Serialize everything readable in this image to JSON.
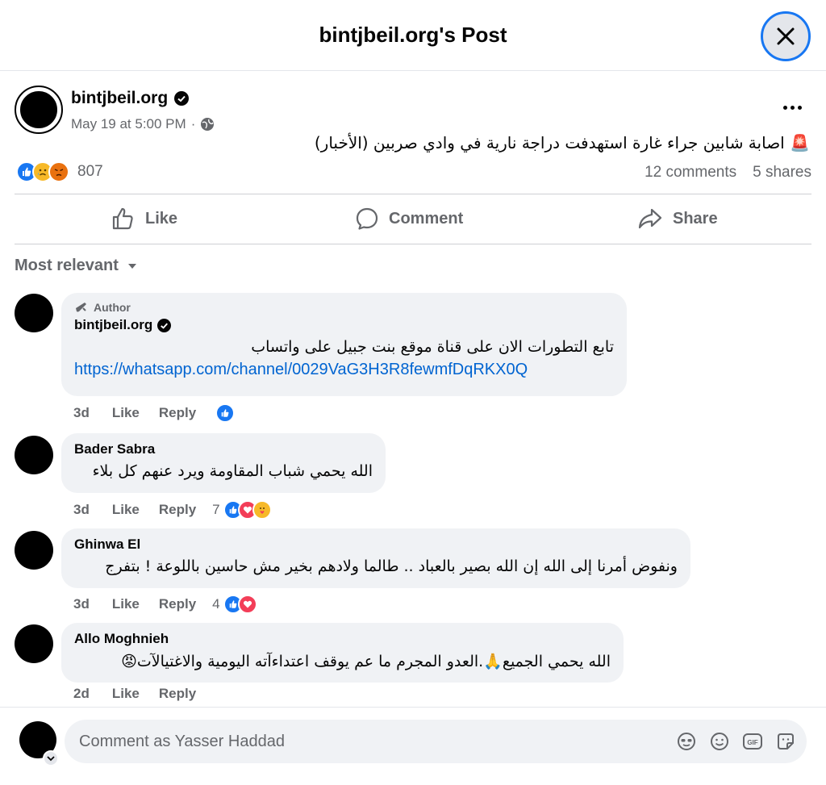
{
  "header": {
    "title": "bintjbeil.org's Post"
  },
  "post": {
    "author": "bintjbeil.org",
    "timestamp": "May 19 at 5:00 PM",
    "separator": "·",
    "text": "🚨 اصابة شابين جراء غارة استهدفت دراجة نارية في وادي صربين (الأخبار)",
    "reaction_count": "807",
    "comments_count": "12 comments",
    "shares_count": "5 shares"
  },
  "actions": {
    "like": "Like",
    "comment": "Comment",
    "share": "Share"
  },
  "sort": {
    "label": "Most relevant"
  },
  "comments": [
    {
      "badge": "Author",
      "author": "bintjbeil.org",
      "text": "تابع التطورات الان على قناة موقع بنت جبيل على واتساب",
      "link": "https://whatsapp.com/channel/0029VaG3H3R8fewmfDqRKX0Q",
      "age": "3d",
      "like": "Like",
      "reply": "Reply"
    },
    {
      "author": "Bader Sabra",
      "text": "الله يحمي شباب المقاومة ويرد عنهم كل بلاء",
      "age": "3d",
      "like": "Like",
      "reply": "Reply",
      "reactions": "7"
    },
    {
      "author": "Ghinwa El",
      "text": "ونفوض أمرنا إلى الله إن الله بصير بالعباد .. طالما ولادهم بخير مش حاسين باللوعة ! بتفرج",
      "age": "3d",
      "like": "Like",
      "reply": "Reply",
      "reactions": "4"
    },
    {
      "author": "Allo Moghnieh",
      "text": "الله يحمي الجميع🙏.العدو المجرم ما عم يوقف اعتداءآته اليومية والاغتيالآت😡",
      "age": "2d",
      "like": "Like",
      "reply": "Reply"
    }
  ],
  "composer": {
    "placeholder": "Comment as Yasser Haddad"
  },
  "colors": {
    "like_blue": "#1877f2",
    "link_blue": "#0064d1",
    "angry_orange": "#e9710f",
    "love_red": "#f33e58",
    "care_yellow": "#f7b928"
  }
}
